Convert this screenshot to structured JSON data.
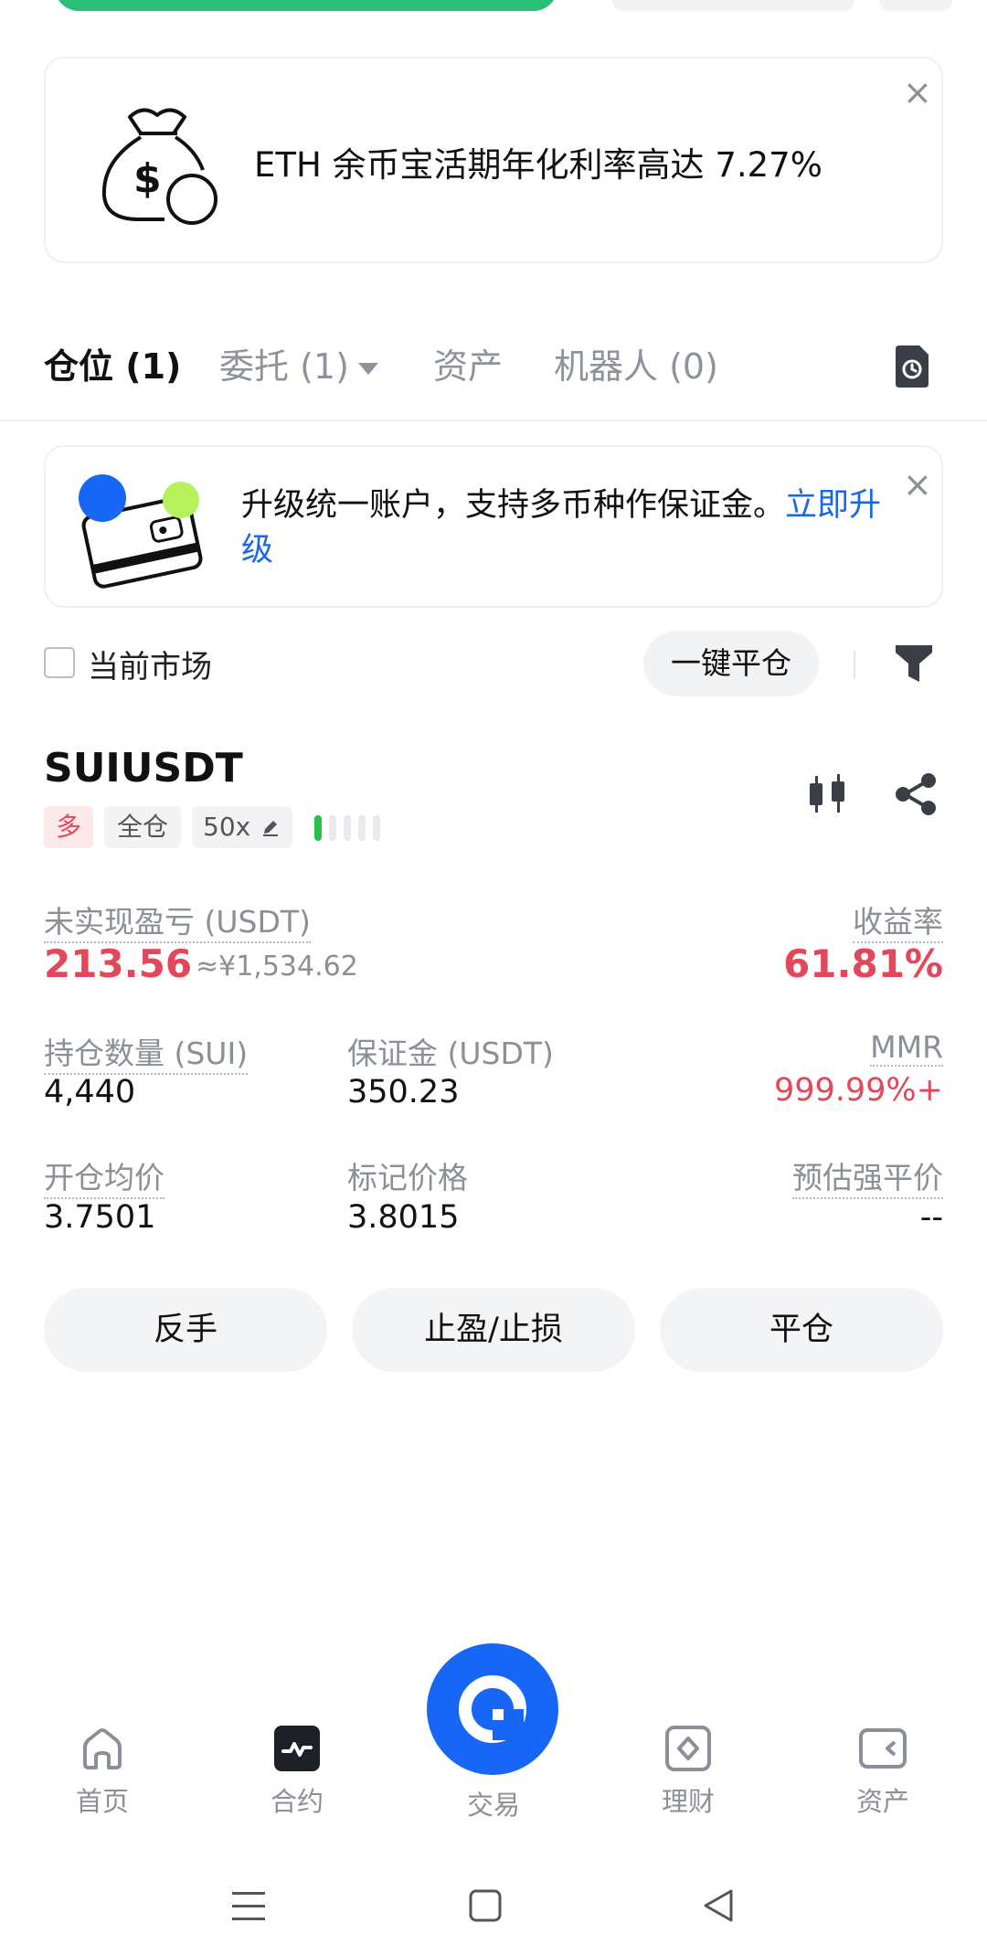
{
  "promo_eth": {
    "text": "ETH 余币宝活期年化利率高达 7.27%",
    "close_label": "×"
  },
  "tabs": [
    {
      "label": "仓位 (1)",
      "active": true
    },
    {
      "label": "委托 (1)",
      "active": false
    },
    {
      "label": "资产",
      "active": false
    },
    {
      "label": "机器人 (0)",
      "active": false
    }
  ],
  "promo_upgrade": {
    "text": "升级统一账户，支持多币种作保证金。",
    "link": "立即升级",
    "close_label": "×"
  },
  "filter": {
    "current_market_label": "当前市场",
    "close_all_label": "一键平仓"
  },
  "position": {
    "symbol": "SUIUSDT",
    "side_tag": "多",
    "margin_mode": "全仓",
    "leverage": "50x",
    "risk_level": 1,
    "unrealized_pnl_label": "未实现盈亏 (USDT)",
    "unrealized_pnl": "213.56",
    "unrealized_pnl_cny": "≈¥1,534.62",
    "roe_label": "收益率",
    "roe": "61.81%",
    "size_label": "持仓数量 (SUI)",
    "size": "4,440",
    "margin_label": "保证金 (USDT)",
    "margin": "350.23",
    "mmr_label": "MMR",
    "mmr": "999.99%+",
    "entry_label": "开仓均价",
    "entry": "3.7501",
    "mark_label": "标记价格",
    "mark": "3.8015",
    "liq_label": "预估强平价",
    "liq": "--"
  },
  "actions": {
    "reverse": "反手",
    "tpsl": "止盈/止损",
    "close": "平仓"
  },
  "bottom_nav": {
    "home": "首页",
    "futures": "合约",
    "trade": "交易",
    "earn": "理财",
    "assets": "资产"
  },
  "colors": {
    "accent_blue": "#1866f5",
    "loss_red": "#e2475a",
    "green": "#2bbf7a"
  }
}
